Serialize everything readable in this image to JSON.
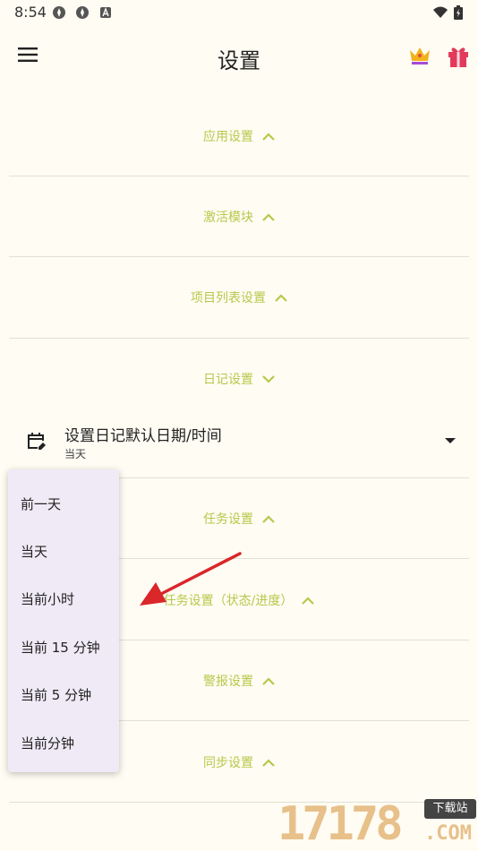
{
  "status_bar": {
    "time": "8:54"
  },
  "app_bar": {
    "title": "设置"
  },
  "sections": [
    {
      "label": "应用设置",
      "chevron": "up"
    },
    {
      "label": "激活模块",
      "chevron": "up"
    },
    {
      "label": "项目列表设置",
      "chevron": "up"
    },
    {
      "label": "日记设置",
      "chevron": "down"
    },
    {
      "label": "任务设置",
      "chevron": "up"
    },
    {
      "label": "任务设置（状态/进度）",
      "chevron": "up"
    },
    {
      "label": "警报设置",
      "chevron": "up"
    },
    {
      "label": "同步设置",
      "chevron": "up"
    }
  ],
  "diary_setting": {
    "title": "设置日记默认日期/时间",
    "value": "当天"
  },
  "dropdown_menu": {
    "options": [
      "前一天",
      "当天",
      "当前小时",
      "当前 15 分钟",
      "当前 5 分钟",
      "当前分钟"
    ]
  },
  "watermark": {
    "digits": "17178",
    "badge": "下载站",
    "suffix": ".COM"
  },
  "colors": {
    "background": "#fffcf3",
    "section_label": "#b5c94a",
    "menu_background": "#efeaf6",
    "annotation_arrow": "#d9272a"
  }
}
